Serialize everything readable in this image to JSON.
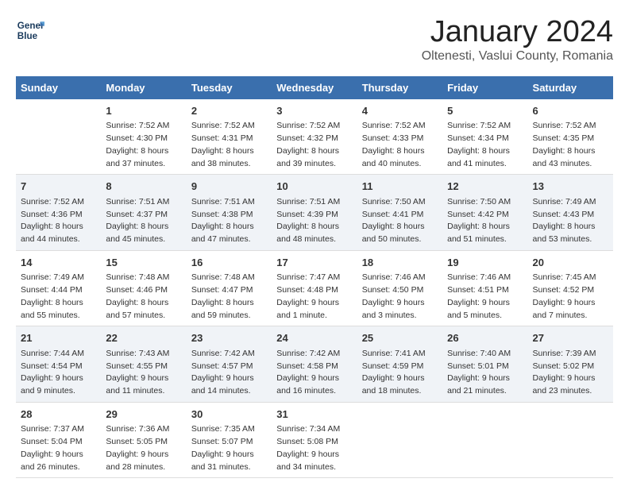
{
  "logo": {
    "line1": "General",
    "line2": "Blue"
  },
  "title": "January 2024",
  "subtitle": "Oltenesti, Vaslui County, Romania",
  "days_of_week": [
    "Sunday",
    "Monday",
    "Tuesday",
    "Wednesday",
    "Thursday",
    "Friday",
    "Saturday"
  ],
  "weeks": [
    [
      {
        "day": "",
        "content": ""
      },
      {
        "day": "1",
        "content": "Sunrise: 7:52 AM\nSunset: 4:30 PM\nDaylight: 8 hours\nand 37 minutes."
      },
      {
        "day": "2",
        "content": "Sunrise: 7:52 AM\nSunset: 4:31 PM\nDaylight: 8 hours\nand 38 minutes."
      },
      {
        "day": "3",
        "content": "Sunrise: 7:52 AM\nSunset: 4:32 PM\nDaylight: 8 hours\nand 39 minutes."
      },
      {
        "day": "4",
        "content": "Sunrise: 7:52 AM\nSunset: 4:33 PM\nDaylight: 8 hours\nand 40 minutes."
      },
      {
        "day": "5",
        "content": "Sunrise: 7:52 AM\nSunset: 4:34 PM\nDaylight: 8 hours\nand 41 minutes."
      },
      {
        "day": "6",
        "content": "Sunrise: 7:52 AM\nSunset: 4:35 PM\nDaylight: 8 hours\nand 43 minutes."
      }
    ],
    [
      {
        "day": "7",
        "content": "Sunrise: 7:52 AM\nSunset: 4:36 PM\nDaylight: 8 hours\nand 44 minutes."
      },
      {
        "day": "8",
        "content": "Sunrise: 7:51 AM\nSunset: 4:37 PM\nDaylight: 8 hours\nand 45 minutes."
      },
      {
        "day": "9",
        "content": "Sunrise: 7:51 AM\nSunset: 4:38 PM\nDaylight: 8 hours\nand 47 minutes."
      },
      {
        "day": "10",
        "content": "Sunrise: 7:51 AM\nSunset: 4:39 PM\nDaylight: 8 hours\nand 48 minutes."
      },
      {
        "day": "11",
        "content": "Sunrise: 7:50 AM\nSunset: 4:41 PM\nDaylight: 8 hours\nand 50 minutes."
      },
      {
        "day": "12",
        "content": "Sunrise: 7:50 AM\nSunset: 4:42 PM\nDaylight: 8 hours\nand 51 minutes."
      },
      {
        "day": "13",
        "content": "Sunrise: 7:49 AM\nSunset: 4:43 PM\nDaylight: 8 hours\nand 53 minutes."
      }
    ],
    [
      {
        "day": "14",
        "content": "Sunrise: 7:49 AM\nSunset: 4:44 PM\nDaylight: 8 hours\nand 55 minutes."
      },
      {
        "day": "15",
        "content": "Sunrise: 7:48 AM\nSunset: 4:46 PM\nDaylight: 8 hours\nand 57 minutes."
      },
      {
        "day": "16",
        "content": "Sunrise: 7:48 AM\nSunset: 4:47 PM\nDaylight: 8 hours\nand 59 minutes."
      },
      {
        "day": "17",
        "content": "Sunrise: 7:47 AM\nSunset: 4:48 PM\nDaylight: 9 hours\nand 1 minute."
      },
      {
        "day": "18",
        "content": "Sunrise: 7:46 AM\nSunset: 4:50 PM\nDaylight: 9 hours\nand 3 minutes."
      },
      {
        "day": "19",
        "content": "Sunrise: 7:46 AM\nSunset: 4:51 PM\nDaylight: 9 hours\nand 5 minutes."
      },
      {
        "day": "20",
        "content": "Sunrise: 7:45 AM\nSunset: 4:52 PM\nDaylight: 9 hours\nand 7 minutes."
      }
    ],
    [
      {
        "day": "21",
        "content": "Sunrise: 7:44 AM\nSunset: 4:54 PM\nDaylight: 9 hours\nand 9 minutes."
      },
      {
        "day": "22",
        "content": "Sunrise: 7:43 AM\nSunset: 4:55 PM\nDaylight: 9 hours\nand 11 minutes."
      },
      {
        "day": "23",
        "content": "Sunrise: 7:42 AM\nSunset: 4:57 PM\nDaylight: 9 hours\nand 14 minutes."
      },
      {
        "day": "24",
        "content": "Sunrise: 7:42 AM\nSunset: 4:58 PM\nDaylight: 9 hours\nand 16 minutes."
      },
      {
        "day": "25",
        "content": "Sunrise: 7:41 AM\nSunset: 4:59 PM\nDaylight: 9 hours\nand 18 minutes."
      },
      {
        "day": "26",
        "content": "Sunrise: 7:40 AM\nSunset: 5:01 PM\nDaylight: 9 hours\nand 21 minutes."
      },
      {
        "day": "27",
        "content": "Sunrise: 7:39 AM\nSunset: 5:02 PM\nDaylight: 9 hours\nand 23 minutes."
      }
    ],
    [
      {
        "day": "28",
        "content": "Sunrise: 7:37 AM\nSunset: 5:04 PM\nDaylight: 9 hours\nand 26 minutes."
      },
      {
        "day": "29",
        "content": "Sunrise: 7:36 AM\nSunset: 5:05 PM\nDaylight: 9 hours\nand 28 minutes."
      },
      {
        "day": "30",
        "content": "Sunrise: 7:35 AM\nSunset: 5:07 PM\nDaylight: 9 hours\nand 31 minutes."
      },
      {
        "day": "31",
        "content": "Sunrise: 7:34 AM\nSunset: 5:08 PM\nDaylight: 9 hours\nand 34 minutes."
      },
      {
        "day": "",
        "content": ""
      },
      {
        "day": "",
        "content": ""
      },
      {
        "day": "",
        "content": ""
      }
    ]
  ]
}
